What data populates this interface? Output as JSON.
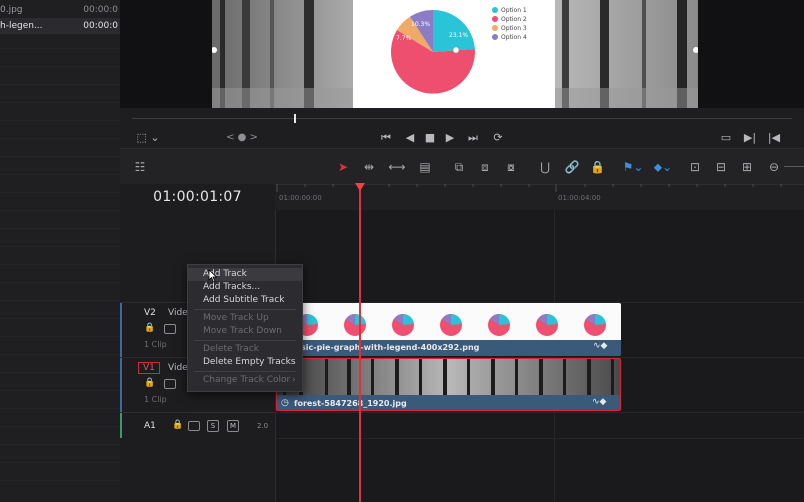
{
  "media_pool": {
    "items": [
      {
        "name": "0.jpg",
        "duration": "00:00:0"
      },
      {
        "name": "h-legen...",
        "duration": "00:00:0"
      }
    ]
  },
  "viewer": {
    "chart_card": {
      "legend": [
        "Option 1",
        "Option 2",
        "Option 3",
        "Option 4"
      ],
      "slice_labels": [
        "23.1%",
        "59%",
        "7.7%",
        "10.3%"
      ],
      "colors": [
        "#2ac4d8",
        "#ef4f6e",
        "#eeaa66",
        "#8c7cc6"
      ]
    },
    "jog_glyphs": "< ● >"
  },
  "timeline": {
    "timecode": "01:00:01:07",
    "ruler_marks": [
      "01:00:00:00",
      "01:00:04:00"
    ],
    "tracks": [
      {
        "id": "V2",
        "name": "Vide",
        "clip_count": "1 Clip"
      },
      {
        "id": "V1",
        "name": "Vide",
        "clip_count": "1 Clip"
      },
      {
        "id": "A1",
        "solo": "S",
        "mute": "M",
        "level": "2.0"
      }
    ],
    "clips": {
      "v2": "sic-pie-graph-with-legend-400x292.png",
      "v1": "forest-5847268_1920.jpg"
    }
  },
  "context_menu": {
    "items": [
      {
        "label": "Add Track",
        "disabled": false
      },
      {
        "label": "Add Tracks...",
        "disabled": false
      },
      {
        "label": "Add Subtitle Track",
        "disabled": false
      },
      {
        "label": "Move Track Up",
        "disabled": true
      },
      {
        "label": "Move Track Down",
        "disabled": true
      },
      {
        "label": "Delete Track",
        "disabled": true
      },
      {
        "label": "Delete Empty Tracks",
        "disabled": false
      },
      {
        "label": "Change Track Color",
        "disabled": true
      }
    ],
    "submenu_arrow": "›"
  },
  "colors": {
    "playhead": "#e0303c",
    "clip_blue": "#3a5a7a",
    "selected_border": "#d0283a"
  }
}
